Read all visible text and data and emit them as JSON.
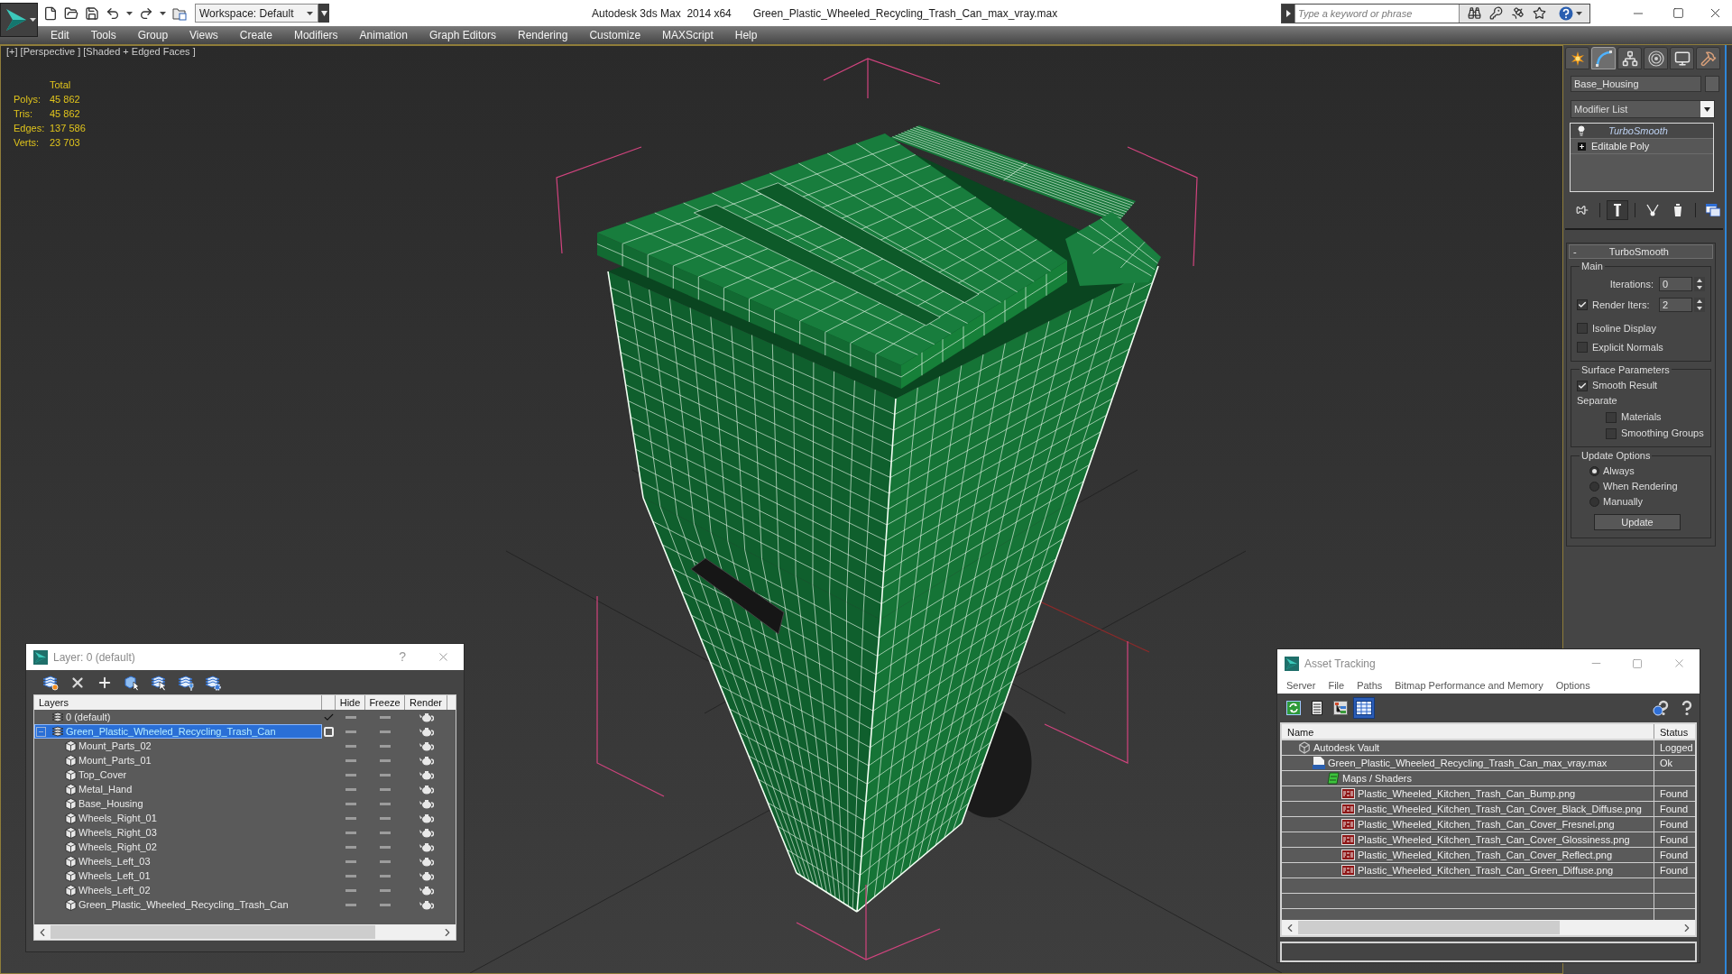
{
  "title_bar": {
    "workspace": "Workspace: Default",
    "app_title": "Autodesk 3ds Max  2014 x64",
    "file_name": "Green_Plastic_Wheeled_Recycling_Trash_Can_max_vray.max",
    "search": {
      "placeholder": "Type a keyword or phrase"
    }
  },
  "menu_bar": [
    "Edit",
    "Tools",
    "Group",
    "Views",
    "Create",
    "Modifiers",
    "Animation",
    "Graph Editors",
    "Rendering",
    "Customize",
    "MAXScript",
    "Help"
  ],
  "viewport": {
    "label": "[+] [Perspective ] [Shaded + Edged Faces ]",
    "stats": {
      "header": "Total",
      "rows": [
        {
          "label": "Polys:",
          "value": "45 862"
        },
        {
          "label": "Tris:",
          "value": "45 862"
        },
        {
          "label": "Edges:",
          "value": "137 586"
        },
        {
          "label": "Verts:",
          "value": "23 703"
        }
      ]
    }
  },
  "command_panel": {
    "tabs": [
      {
        "kind": "create",
        "selected": false
      },
      {
        "kind": "modify",
        "selected": true
      },
      {
        "kind": "hierarchy",
        "selected": false
      },
      {
        "kind": "motion",
        "selected": false
      },
      {
        "kind": "display",
        "selected": false
      },
      {
        "kind": "utilities",
        "selected": false
      }
    ],
    "object_name": "Base_Housing",
    "modifier_list": "Modifier List",
    "stack": [
      {
        "label": "TurboSmooth",
        "selected": true,
        "on": true
      },
      {
        "label": "Editable Poly",
        "selected": false,
        "expanded": false
      }
    ],
    "stack_tools": [
      {
        "kind": "pin",
        "pressed": false
      },
      {
        "kind": "end_result",
        "pressed": true
      },
      {
        "kind": "unique",
        "pressed": false
      },
      {
        "kind": "remove",
        "pressed": false
      },
      {
        "kind": "configure",
        "pressed": false
      }
    ],
    "rollout": {
      "toggle": "-",
      "title": "TurboSmooth",
      "main": {
        "title": "Main",
        "iterations": {
          "label": "Iterations:",
          "value": "0"
        },
        "render_iters": {
          "label": "Render Iters:",
          "value": "2",
          "checked": true
        },
        "options": [
          {
            "label": "Isoline Display",
            "checked": false
          },
          {
            "label": "Explicit Normals",
            "checked": false
          }
        ]
      },
      "surface": {
        "title": "Surface Parameters",
        "smooth_result": {
          "label": "Smooth Result",
          "checked": true
        },
        "separate": {
          "label": "Separate",
          "options": [
            {
              "label": "Materials",
              "checked": false
            },
            {
              "label": "Smoothing Groups",
              "checked": false
            }
          ]
        }
      },
      "update": {
        "title": "Update Options",
        "options": [
          {
            "label": "Always",
            "selected": true
          },
          {
            "label": "When Rendering",
            "selected": false
          },
          {
            "label": "Manually",
            "selected": false
          }
        ],
        "button": "Update"
      }
    }
  },
  "layer_dialog": {
    "title": "Layer: 0 (default)",
    "help": "?",
    "columns": [
      "Layers",
      "Hide",
      "Freeze",
      "Render"
    ],
    "layers": [
      {
        "name": "0 (default)",
        "current": true,
        "selected": false,
        "hidden": false,
        "frozen": false,
        "renderable": true
      },
      {
        "name": "Green_Plastic_Wheeled_Recycling_Trash_Can",
        "current": false,
        "selected": true,
        "expanded": true,
        "hidden": false,
        "frozen": false,
        "renderable": true,
        "children": [
          {
            "name": "Mount_Parts_02",
            "hidden": false,
            "frozen": false,
            "renderable": true
          },
          {
            "name": "Mount_Parts_01",
            "hidden": false,
            "frozen": false,
            "renderable": true
          },
          {
            "name": "Top_Cover",
            "hidden": false,
            "frozen": false,
            "renderable": true
          },
          {
            "name": "Metal_Hand",
            "hidden": false,
            "frozen": false,
            "renderable": true
          },
          {
            "name": "Base_Housing",
            "hidden": false,
            "frozen": false,
            "renderable": true
          },
          {
            "name": "Wheels_Right_01",
            "hidden": false,
            "frozen": false,
            "renderable": true
          },
          {
            "name": "Wheels_Right_03",
            "hidden": false,
            "frozen": false,
            "renderable": true
          },
          {
            "name": "Wheels_Right_02",
            "hidden": false,
            "frozen": false,
            "renderable": true
          },
          {
            "name": "Wheels_Left_03",
            "hidden": false,
            "frozen": false,
            "renderable": true
          },
          {
            "name": "Wheels_Left_01",
            "hidden": false,
            "frozen": false,
            "renderable": true
          },
          {
            "name": "Wheels_Left_02",
            "hidden": false,
            "frozen": false,
            "renderable": true
          },
          {
            "name": "Green_Plastic_Wheeled_Recycling_Trash_Can",
            "hidden": false,
            "frozen": false,
            "renderable": true
          }
        ]
      }
    ]
  },
  "asset_tracking": {
    "title": "Asset Tracking",
    "menu": [
      "Server",
      "File",
      "Paths",
      "Bitmap Performance and Memory",
      "Options"
    ],
    "toolbar": [
      {
        "kind": "refresh",
        "selected": false
      },
      {
        "kind": "list",
        "selected": false
      },
      {
        "kind": "tree",
        "selected": false
      },
      {
        "kind": "table",
        "selected": true
      }
    ],
    "columns": [
      "Name",
      "Status"
    ],
    "assets": [
      {
        "kind": "vault",
        "name": "Autodesk Vault",
        "status": "Logged",
        "children": [
          {
            "kind": "scene",
            "name": "Green_Plastic_Wheeled_Recycling_Trash_Can_max_vray.max",
            "status": "Ok",
            "children": [
              {
                "kind": "folder",
                "name": "Maps / Shaders",
                "children": [
                  {
                    "kind": "png",
                    "name": "Plastic_Wheeled_Kitchen_Trash_Can_Bump.png",
                    "status": "Found"
                  },
                  {
                    "kind": "png",
                    "name": "Plastic_Wheeled_Kitchen_Trash_Can_Cover_Black_Diffuse.png",
                    "status": "Found"
                  },
                  {
                    "kind": "png",
                    "name": "Plastic_Wheeled_Kitchen_Trash_Can_Cover_Fresnel.png",
                    "status": "Found"
                  },
                  {
                    "kind": "png",
                    "name": "Plastic_Wheeled_Kitchen_Trash_Can_Cover_Glossiness.png",
                    "status": "Found"
                  },
                  {
                    "kind": "png",
                    "name": "Plastic_Wheeled_Kitchen_Trash_Can_Cover_Reflect.png",
                    "status": "Found"
                  },
                  {
                    "kind": "png",
                    "name": "Plastic_Wheeled_Kitchen_Trash_Can_Green_Diffuse.png",
                    "status": "Found"
                  }
                ]
              }
            ]
          }
        ]
      }
    ]
  }
}
